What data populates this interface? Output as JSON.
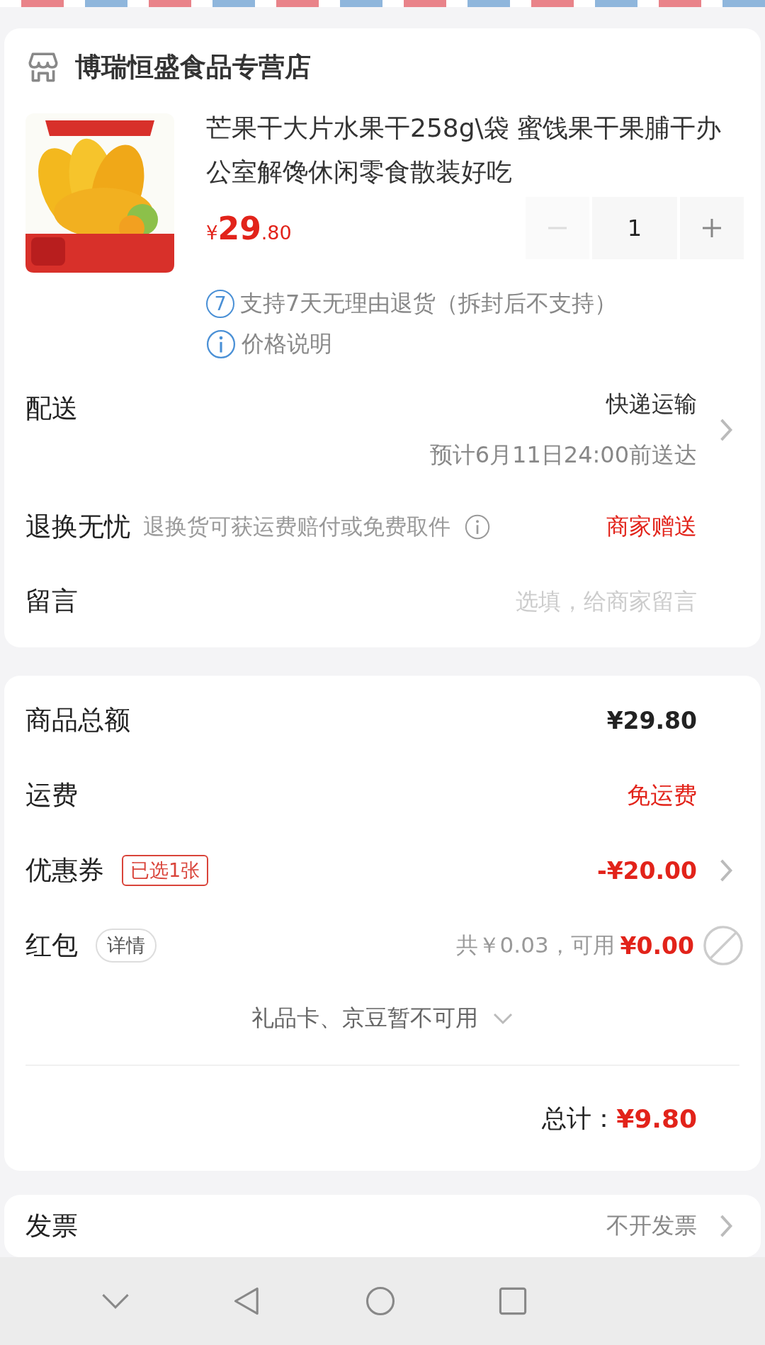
{
  "store": {
    "name": "博瑞恒盛食品专营店"
  },
  "product": {
    "kind": "picture",
    "title": "芒果干大片水果干258g\\袋 蜜饯果干果脯干办公室解馋休闲零食散装好吃",
    "currency": "¥",
    "price_int": "29",
    "price_dec": ".80",
    "quantity": "1",
    "minus_disabled": true
  },
  "notes": [
    {
      "kind": "badge",
      "badge": "7",
      "text": "支持7天无理由退货（拆封后不支持）"
    },
    {
      "kind": "info",
      "text": "价格说明"
    }
  ],
  "delivery": {
    "label": "配送",
    "value": "快递运输",
    "sub": "预计6月11日24:00前送达"
  },
  "returns": {
    "label": "退换无忧",
    "desc": "退换货可获运费赔付或免费取件",
    "value": "商家赠送"
  },
  "message": {
    "label": "留言",
    "placeholder": "选填，给商家留言"
  },
  "summary": [
    {
      "kind": "plain",
      "label": "商品总额",
      "value": "¥29.80"
    },
    {
      "kind": "red",
      "label": "运费",
      "value": "免运费"
    },
    {
      "kind": "coupon",
      "label": "优惠券",
      "tag": "已选1张",
      "value": "-¥20.00"
    },
    {
      "kind": "redpacket",
      "label": "红包",
      "tag": "详情",
      "note": "共￥0.03，可用",
      "value": "¥0.00",
      "checked": false
    }
  ],
  "gift": {
    "text": "礼品卡、京豆暂不可用",
    "expanded": false
  },
  "total": {
    "label": "总计：",
    "value": "¥9.80"
  },
  "invoice": {
    "label": "发票",
    "value": "不开发票"
  }
}
